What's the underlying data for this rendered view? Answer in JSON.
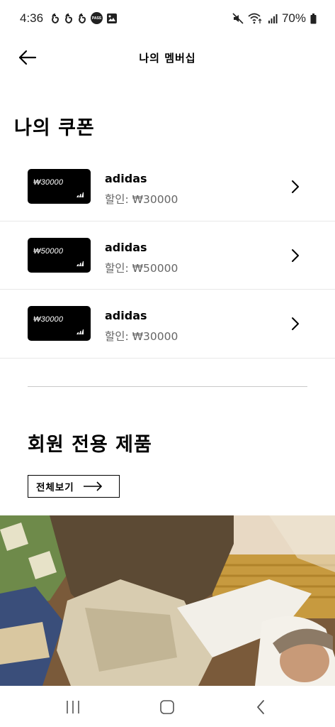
{
  "status_bar": {
    "time": "4:36",
    "battery": "70%",
    "left_icons": [
      "notification-icon",
      "notification-icon",
      "notification-icon",
      "pass-icon",
      "gallery-icon"
    ],
    "pass_label": "PASS",
    "right_icons": [
      "mute-icon",
      "wifi-icon",
      "signal-icon",
      "battery-icon"
    ]
  },
  "header": {
    "title": "나의 멤버십",
    "back_icon": "arrow-left-icon"
  },
  "coupons": {
    "title": "나의 쿠폰",
    "items": [
      {
        "card_value": "₩30000",
        "brand": "adidas",
        "discount": "할인: ₩30000"
      },
      {
        "card_value": "₩50000",
        "brand": "adidas",
        "discount": "할인: ₩50000"
      },
      {
        "card_value": "₩30000",
        "brand": "adidas",
        "discount": "할인: ₩30000"
      }
    ]
  },
  "member_products": {
    "title": "회원 전용 제품",
    "view_all_label": "전체보기"
  },
  "nav_bar": {
    "buttons": [
      "recent-apps-icon",
      "home-icon",
      "back-icon"
    ]
  },
  "colors": {
    "card_background": "#000000",
    "text_primary": "#000000",
    "text_secondary": "#666666",
    "divider": "#e8e8e8"
  }
}
